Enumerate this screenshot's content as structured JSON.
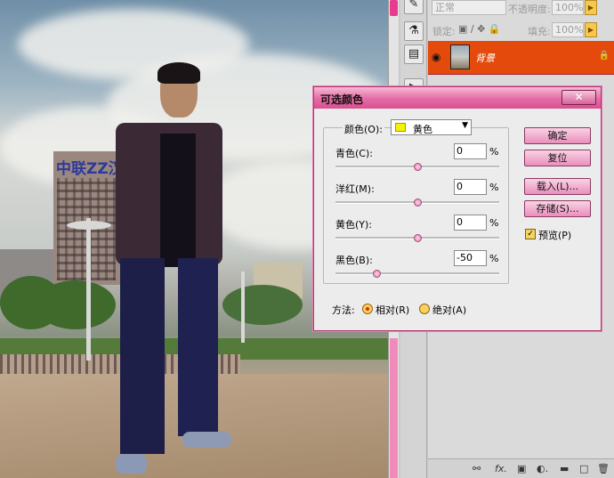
{
  "photo": {
    "building_sign": "中联ZZ汉"
  },
  "layers_panel": {
    "blend_mode": "正常",
    "opacity_label": "不透明度:",
    "opacity_value": "100%",
    "lock_label": "锁定:",
    "fill_label": "填充:",
    "fill_value": "100%",
    "layer_name": "背景"
  },
  "dialog": {
    "title": "可选颜色",
    "colors_label": "颜色(O):",
    "colors_value": "黄色",
    "swatch_color": "#f7f200",
    "channels": [
      {
        "label": "青色(C):",
        "value": "0",
        "unit": "%",
        "slider_pct": 50
      },
      {
        "label": "洋红(M):",
        "value": "0",
        "unit": "%",
        "slider_pct": 50
      },
      {
        "label": "黄色(Y):",
        "value": "0",
        "unit": "%",
        "slider_pct": 50
      },
      {
        "label": "黑色(B):",
        "value": "-50",
        "unit": "%",
        "slider_pct": 25
      }
    ],
    "buttons": {
      "ok": "确定",
      "reset": "复位",
      "load": "载入(L)...",
      "save": "存储(S)..."
    },
    "preview_label": "预览(P)",
    "preview_checked": true,
    "method_label": "方法:",
    "method_options": [
      "相对(R)",
      "绝对(A)"
    ],
    "method_selected": "相对(R)",
    "accent_color": "#e46aa4"
  }
}
